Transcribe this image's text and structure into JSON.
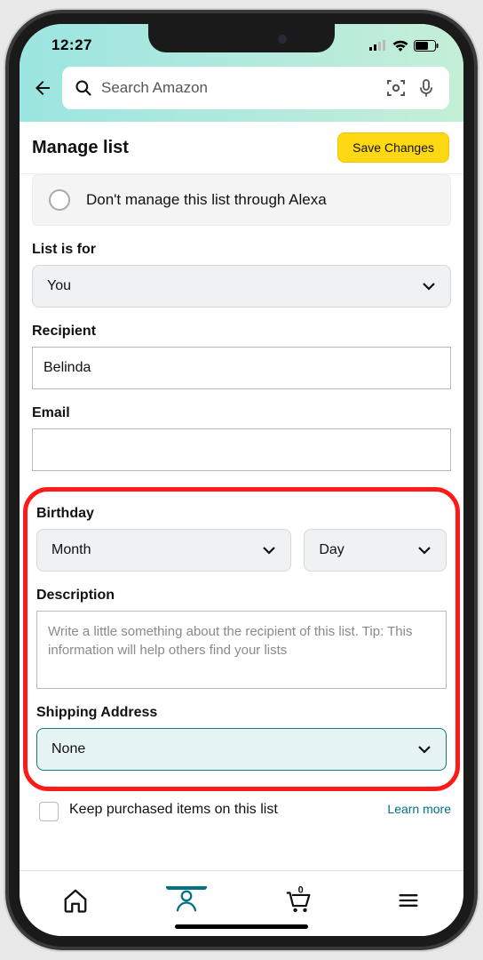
{
  "status": {
    "time": "12:27"
  },
  "search": {
    "placeholder": "Search Amazon"
  },
  "titlebar": {
    "title": "Manage list",
    "save": "Save Changes"
  },
  "alexa": {
    "label": "Don't manage this list through Alexa"
  },
  "fields": {
    "list_for": {
      "label": "List is for",
      "value": "You"
    },
    "recipient": {
      "label": "Recipient",
      "value": "Belinda"
    },
    "email": {
      "label": "Email",
      "value": ""
    },
    "birthday": {
      "label": "Birthday",
      "month": "Month",
      "day": "Day"
    },
    "description": {
      "label": "Description",
      "placeholder": "Write a little something about the recipient of this list. Tip: This information will help others find your lists"
    },
    "shipping": {
      "label": "Shipping Address",
      "value": "None"
    },
    "keep": {
      "label": "Keep purchased items on this list",
      "learn": "Learn more"
    }
  }
}
